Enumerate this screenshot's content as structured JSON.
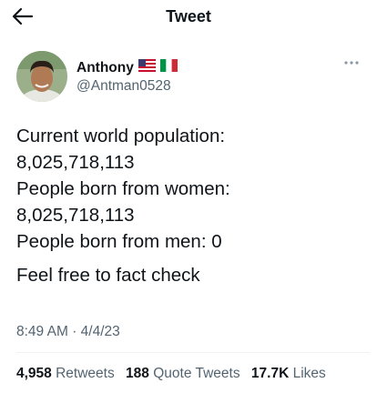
{
  "header": {
    "title": "Tweet"
  },
  "author": {
    "display_name": "Anthony",
    "handle": "@Antman0528",
    "flags": [
      "us-flag-icon",
      "italy-flag-icon"
    ]
  },
  "tweet": {
    "lines": [
      "Current world population:",
      "8,025,718,113",
      "People born from women:",
      "8,025,718,113",
      "People born from men: 0",
      "Feel free to fact check"
    ]
  },
  "meta": {
    "time": "8:49 AM",
    "separator": "·",
    "date": "4/4/23"
  },
  "stats": {
    "retweets_count": "4,958",
    "retweets_label": "Retweets",
    "quotes_count": "188",
    "quotes_label": "Quote Tweets",
    "likes_count": "17.7K",
    "likes_label": "Likes"
  },
  "colors": {
    "text": "#0f1419",
    "secondary": "#536471",
    "divider": "#eff3f4"
  }
}
